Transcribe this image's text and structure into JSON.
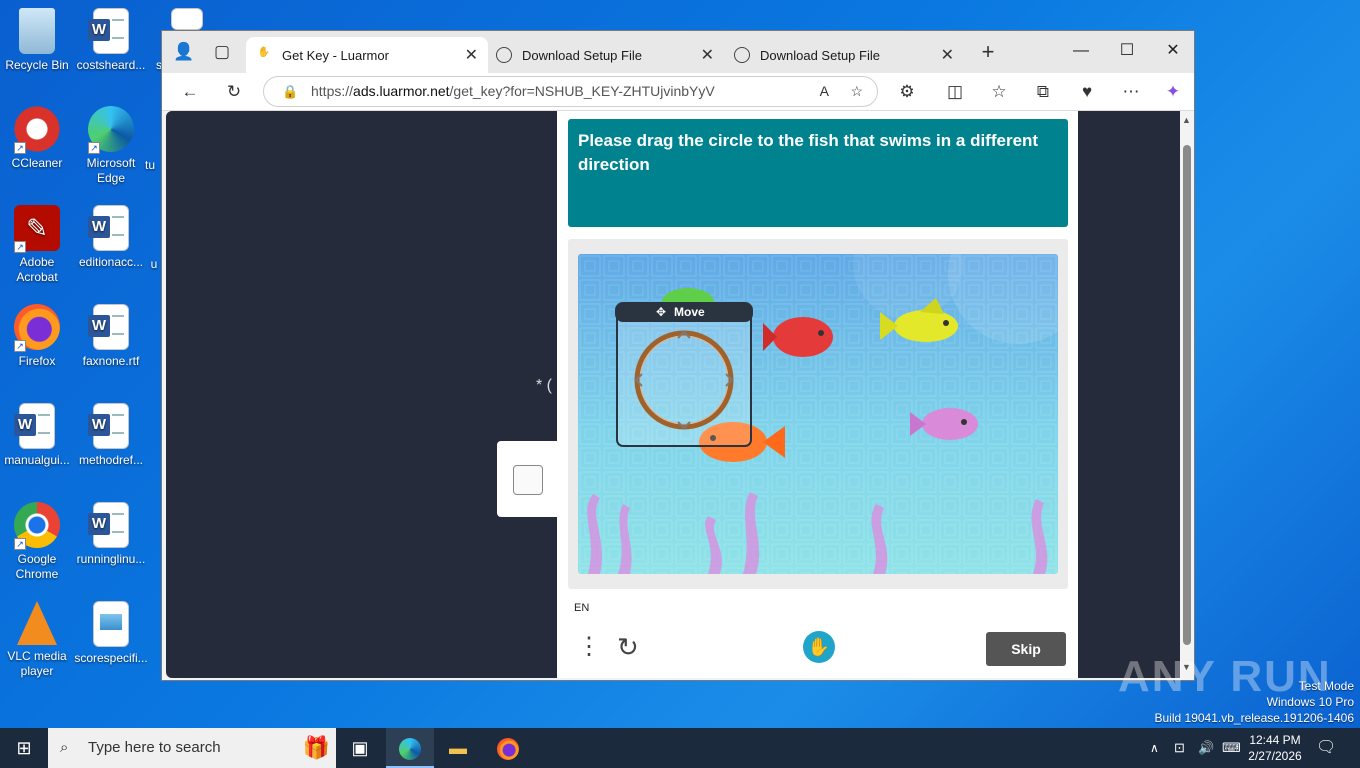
{
  "desktop": {
    "icons": [
      {
        "label": "Recycle Bin",
        "icon": "recycle-bin-icon"
      },
      {
        "label": "costsheard...",
        "icon": "word-document-icon"
      },
      {
        "label": "CCleaner",
        "icon": "ccleaner-icon"
      },
      {
        "label": "Microsoft Edge",
        "icon": "edge-icon"
      },
      {
        "label": "Adobe Acrobat",
        "icon": "acrobat-icon"
      },
      {
        "label": "editionacc...",
        "icon": "word-document-icon"
      },
      {
        "label": "Firefox",
        "icon": "firefox-icon"
      },
      {
        "label": "faxnone.rtf",
        "icon": "word-document-icon"
      },
      {
        "label": "manualgui...",
        "icon": "word-document-icon"
      },
      {
        "label": "methodref...",
        "icon": "word-document-icon"
      },
      {
        "label": "Google Chrome",
        "icon": "chrome-icon"
      },
      {
        "label": "runninglinu...",
        "icon": "word-document-icon"
      },
      {
        "label": "VLC media player",
        "icon": "vlc-icon"
      },
      {
        "label": "scorespecifi...",
        "icon": "image-file-icon"
      }
    ],
    "partial_labels": {
      "a": "tu",
      "b": "u",
      "c": "s"
    }
  },
  "browser": {
    "tabs": [
      {
        "title": "Get Key - Luarmor",
        "icon": "luarmor-icon",
        "active": true
      },
      {
        "title": "Download Setup File",
        "icon": "globe-icon",
        "active": false
      },
      {
        "title": "Download Setup File",
        "icon": "globe-icon",
        "active": false
      }
    ],
    "url_prefix": "https://",
    "url_host": "ads.luarmor.net",
    "url_path": "/get_key?for=NSHUB_KEY-ZHTUjvinbYyV"
  },
  "page": {
    "partial_text": "* (",
    "captcha": {
      "prompt": "Please drag the circle to the fish that swims in a different direction",
      "move_label": "Move",
      "language": "EN",
      "skip_label": "Skip",
      "colors": {
        "header": "#00838f",
        "skip": "#555555"
      }
    }
  },
  "taskbar": {
    "search_placeholder": "Type here to search",
    "time": "12:44 PM",
    "date": "2/27/2026"
  },
  "watermark": {
    "brand": "ANY RUN",
    "line1": "Test Mode",
    "line2": "Windows 10 Pro",
    "line3": "Build 19041.vb_release.191206-1406"
  }
}
